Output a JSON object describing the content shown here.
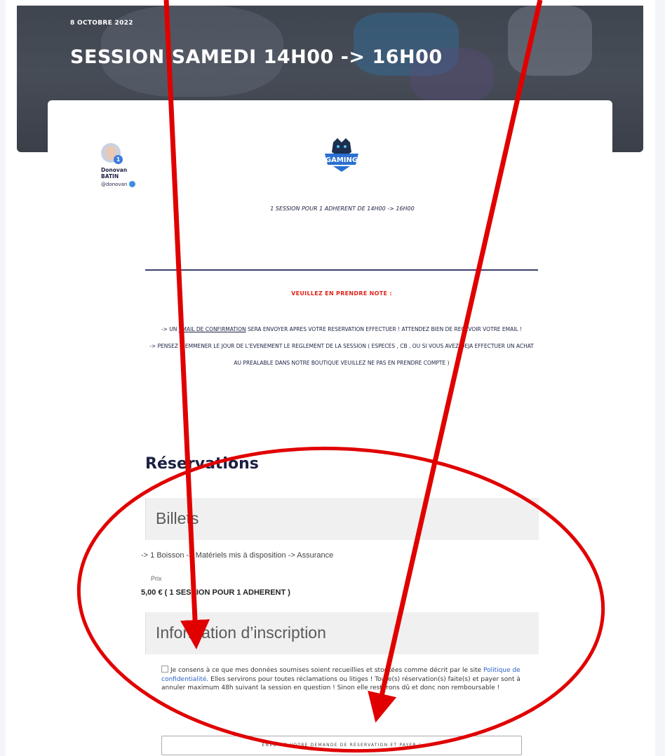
{
  "hero": {
    "date": "8 OCTOBRE 2022",
    "title": "SESSION SAMEDI 14H00 -> 16H00"
  },
  "author": {
    "first_name": "Donovan",
    "last_name": "BATIN",
    "handle": "@donovan",
    "badge": "1"
  },
  "event": {
    "logo_text": "GAMING",
    "subtitle": "1 SESSION POUR 1 ADHERENT DE 14H00 -> 16H00",
    "note_heading": "VEUILLEZ EN PRENDRE NOTE :",
    "note1_prefix": "-> UN ",
    "note1_link": "EMAIL DE CONFIRMATION",
    "note1_suffix": " SERA ENVOYER APRES VOTRE RESERVATION EFFECTUER ! ATTENDEZ BIEN DE RECEVOIR VOTRE EMAIL !",
    "note2": "-> PENSEZ A EMMENER LE JOUR DE L'EVENEMENT LE REGLEMENT DE LA SESSION ( ESPECES , CB , OU SI VOUS AVEZ DEJA EFFECTUER UN ACHAT AU PREALABLE DANS NOTRE BOUTIQUE VEUILLEZ NE PAS EN PRENDRE COMPTE )"
  },
  "reservations": {
    "title": "Réservations",
    "billets_heading": "Billets",
    "ticket_description": "-> 1 Boisson -> Matériels mis à disposition -> Assurance",
    "price_label": "Prix",
    "price_value": "5,00 € ( 1 SESSION POUR 1 ADHERENT )",
    "info_heading": "Information d’inscription",
    "consent_prefix": "Je consens à ce que mes données soumises soient recueillies et stockées comme décrit par le site ",
    "consent_link": "Politique de confidentialité",
    "consent_suffix": ". Elles servirons pour toutes réclamations ou litiges ! Toute(s) réservation(s) faite(s) et payer sont à annuler maximum 48h suivant la session en question ! Sinon elle resterons dû et donc non remboursable !",
    "submit_label": "ENVOYER VOTRE DEMANDE DE RÉSERVATION ET PAYER !"
  },
  "colors": {
    "annotation": "#e00000",
    "heading": "#1c2143",
    "note_red": "#e0241c"
  }
}
